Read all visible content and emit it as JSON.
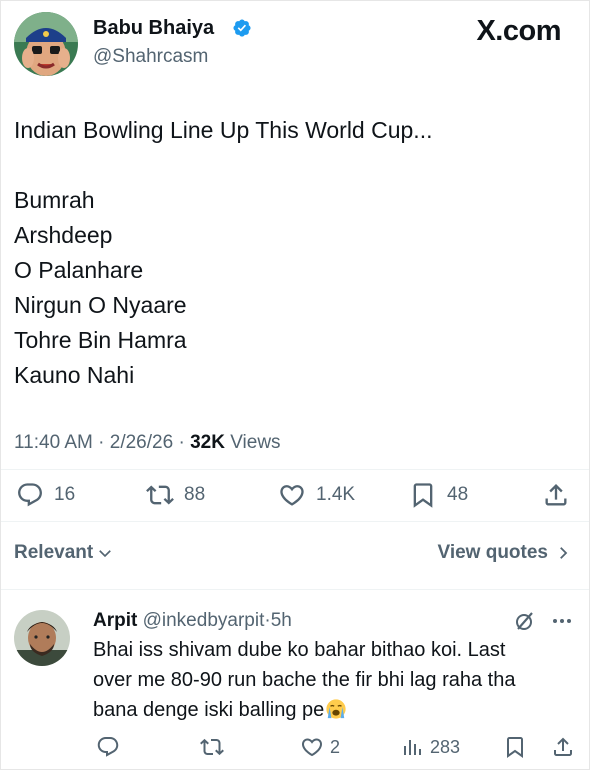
{
  "header": {
    "author_name": "Babu Bhaiya",
    "handle": "@Shahrcasm",
    "brand": "X.com"
  },
  "tweet": {
    "lines": [
      "Indian Bowling Line Up This World Cup...",
      "",
      "Bumrah",
      "Arshdeep",
      "O Palanhare",
      "Nirgun O Nyaare",
      "Tohre Bin Hamra",
      "Kauno Nahi"
    ],
    "time": "11:40 AM",
    "separator": "·",
    "date": "2/26/26",
    "views_count": "32K",
    "views_label": "Views"
  },
  "actions": {
    "replies": "16",
    "reposts": "88",
    "likes": "1.4K",
    "bookmarks": "48"
  },
  "sort": {
    "label": "Relevant",
    "view_quotes": "View quotes"
  },
  "reply": {
    "name": "Arpit",
    "handle": "@inkedbyarpit",
    "separator": "·",
    "age": "5h",
    "lines": [
      "Bhai iss shivam dube ko bahar bithao koi. Last",
      "over me 80-90 run bache the fir bhi lag raha tha",
      "bana denge iski balling pe"
    ],
    "emoji": "loudly-crying-face",
    "likes": "2",
    "views": "283"
  },
  "colors": {
    "text": "#0f1419",
    "secondary": "#536471",
    "verified": "#1d9bf0",
    "divider": "#eff3f4"
  },
  "icons": [
    "verified-badge-icon",
    "reply-icon",
    "repost-icon",
    "like-icon",
    "bookmark-icon",
    "share-icon",
    "chevron-down-icon",
    "chevron-right-icon",
    "grok-icon",
    "more-icon",
    "views-icon"
  ]
}
